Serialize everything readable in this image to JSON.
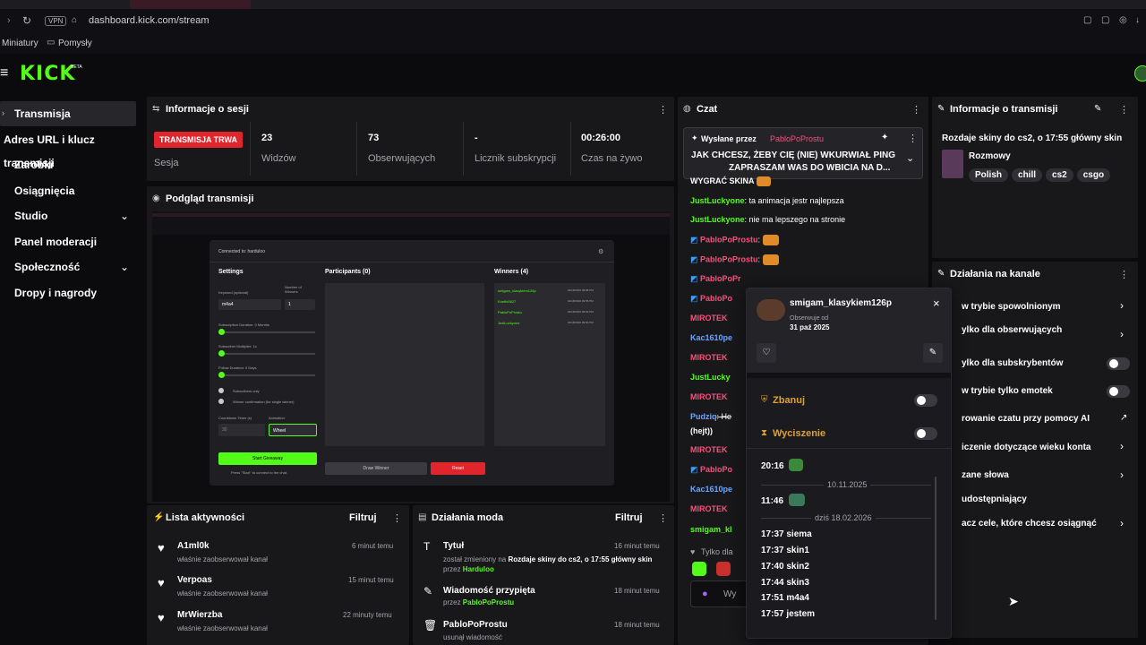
{
  "browser": {
    "url": "dashboard.kick.com/stream",
    "vpn": "VPN",
    "bookmarks": [
      "Miniatury",
      "Pomysły"
    ]
  },
  "brand": {
    "logo": "KICK",
    "beta": "BETA",
    "accent": "#53fc18"
  },
  "sidebar": {
    "items": [
      {
        "label": "Transmisja",
        "active": true
      },
      {
        "label": "Adres URL i klucz transmisji"
      },
      {
        "label": "Zarobki"
      },
      {
        "label": "Osiągnięcia"
      },
      {
        "label": "Studio"
      },
      {
        "label": "Panel moderacji"
      },
      {
        "label": "Społeczność"
      },
      {
        "label": "Dropy i nagrody"
      }
    ]
  },
  "session": {
    "title": "Informacje o sesji",
    "status": "TRANSMISJA TRWA",
    "status_label": "Sesja",
    "stats": [
      {
        "value": "23",
        "label": "Widzów"
      },
      {
        "value": "73",
        "label": "Obserwujących"
      },
      {
        "value": "-",
        "label": "Licznik subskrypcji"
      },
      {
        "value": "00:26:00",
        "label": "Czas na żywo"
      }
    ]
  },
  "preview": {
    "title": "Podgląd transmisji",
    "inner": {
      "connected": "Connected to: harduloo",
      "settings": "Settings",
      "participants": "Participants (0)",
      "winners": "Winners (4)",
      "keyword_label": "Keyword (optional)",
      "keyword_value": "m4a4",
      "number_label": "Number of Winners",
      "number_value": "1",
      "sub_duration": "Subscription Duration: 0 Months",
      "sub_multiplier": "Subscriber Multiplier: 1x",
      "follow_duration": "Follow Duration: 0 Days",
      "subs_only": "Subscribers only",
      "winner_confirm": "Winner confirmation (for single winner)",
      "countdown_label": "Countdown Timer (s)",
      "countdown_value": "30",
      "animation_label": "Animation",
      "animation_value": "Wheel",
      "start_button": "Start Giveaway",
      "press_start": "Press \"Start\" to connect to the chat.",
      "draw_button": "Draw Winner",
      "reset_button": "Reset",
      "winners_list": [
        {
          "name": "smigam_klasykiem126p",
          "time": "02/18/2026 09:58 PM"
        },
        {
          "name": "Koelfo5627",
          "time": "02/18/2026 09:55 PM"
        },
        {
          "name": "PabloPoProstu",
          "time": "02/18/2026 09:52 PM"
        },
        {
          "name": "JustLuckyone",
          "time": "02/18/2026 09:50 PM"
        }
      ]
    }
  },
  "activity": {
    "title": "Lista aktywności",
    "filter": "Filtruj",
    "items": [
      {
        "name": "A1ml0k",
        "desc": "właśnie zaobserwował kanał",
        "time": "6 minut temu"
      },
      {
        "name": "Verpoas",
        "desc": "właśnie zaobserwował kanał",
        "time": "15 minut temu"
      },
      {
        "name": "MrWierzba",
        "desc": "właśnie zaobserwował kanał",
        "time": "22 minuty temu"
      }
    ]
  },
  "modactions": {
    "title": "Działania moda",
    "filter": "Filtruj",
    "items": [
      {
        "title": "Tytuł",
        "line1": "został zmieniony na ",
        "bold": "Rozdaje skiny do cs2, o 17:55 główny skin",
        "by": " przez ",
        "user": "Harduloo",
        "time": "16 minut temu"
      },
      {
        "title": "Wiadomość przypięta",
        "line1": "przez ",
        "bold": "",
        "by": "",
        "user": "PabloPoProstu",
        "time": "18 minut temu"
      },
      {
        "title": "PabloPoProstu",
        "line1": "usunął wiadomość",
        "bold": "",
        "by": "",
        "user": "",
        "time": "18 minut temu"
      }
    ]
  },
  "chat": {
    "title": "Czat",
    "pinned_by_label": "Wysłane przez",
    "pinned_by": "PabloPoProstu",
    "pinned_text": "JAK CHCESZ, ŻEBY CIĘ (NIE) WKURWIAŁ PING",
    "pinned_text2": "ZAPRASZAM WAS DO WBICIA NA D...",
    "messages": [
      {
        "user": "",
        "text": "WYGRAĆ SKINA",
        "color": "#ffffff"
      },
      {
        "user": "JustLuckyone",
        "text": ": ta animacja jestr najlepsza",
        "color": "#53fc18"
      },
      {
        "user": "JustLuckyone",
        "text": ": nie ma lepszego na stronie",
        "color": "#53fc18"
      },
      {
        "user": "PabloPoProstu",
        "text": ":",
        "color": "#ff4d7a"
      },
      {
        "user": "PabloPoProstu",
        "text": ":",
        "color": "#ff4d7a"
      },
      {
        "user": "PabloPoPr",
        "text": "",
        "color": "#ff4d7a"
      },
      {
        "user": "PabloPo",
        "text": "",
        "color": "#ff4d7a"
      },
      {
        "user": "MIROTEK",
        "text": "",
        "color": "#ff4d7a"
      },
      {
        "user": "Kac1610pe",
        "text": "",
        "color": "#6aa6ff"
      },
      {
        "user": "MIROTEK",
        "text": "",
        "color": "#ff4d7a"
      },
      {
        "user": "JustLucky",
        "text": "",
        "color": "#53fc18"
      },
      {
        "user": "MIROTEK",
        "text": "",
        "color": "#ff4d7a"
      },
      {
        "user": "Pudziq",
        "text": ": He",
        "color": "#6aa6ff"
      },
      {
        "user": "",
        "text": "(hejt))",
        "color": "#ffffff"
      },
      {
        "user": "MIROTEK",
        "text": "",
        "color": "#ff4d7a"
      },
      {
        "user": "PabloPo",
        "text": "",
        "color": "#ff4d7a"
      },
      {
        "user": "Kac1610pe",
        "text": "",
        "color": "#6aa6ff"
      },
      {
        "user": "MIROTEK",
        "text": "",
        "color": "#ff4d7a"
      },
      {
        "user": "smigam_kl",
        "text": "",
        "color": "#53fc18"
      }
    ],
    "only_label": "Tylko dla",
    "input_placeholder": "Wy"
  },
  "user_popup": {
    "username": "smigam_klasykiem126p",
    "follows_label": "Obserwuje od",
    "follows_date": "31 paź 2025",
    "ban": "Zbanuj",
    "timeout": "Wyciszenie",
    "history": [
      {
        "type": "msg",
        "time": "20:16",
        "text": ""
      },
      {
        "type": "sep",
        "text": "10.11.2025"
      },
      {
        "type": "msg",
        "time": "11:46",
        "text": ""
      },
      {
        "type": "sep",
        "text": "dziś 18.02.2026"
      },
      {
        "type": "msg",
        "time": "17:37",
        "text": "siema"
      },
      {
        "type": "msg",
        "time": "17:37",
        "text": "skin1"
      },
      {
        "type": "msg",
        "time": "17:40",
        "text": "skin2"
      },
      {
        "type": "msg",
        "time": "17:44",
        "text": "skin3"
      },
      {
        "type": "msg",
        "time": "17:51",
        "text": "m4a4"
      },
      {
        "type": "msg",
        "time": "17:57",
        "text": "jestem"
      }
    ]
  },
  "stream_info": {
    "title": "Informacje o transmisji",
    "stream_title": "Rozdaje skiny do cs2, o 17:55 główny skin",
    "category": "Rozmowy",
    "tags": [
      "Polish",
      "chill",
      "cs2",
      "csgo"
    ]
  },
  "channel_actions": {
    "title": "Działania na kanale",
    "items": [
      {
        "label": "w trybie spowolnionym",
        "control": "chevron"
      },
      {
        "label": "ylko dla obserwujących",
        "control": "chevron"
      },
      {
        "label": "ylko dla subskrybentów",
        "control": "toggle"
      },
      {
        "label": "w trybie tylko emotek",
        "control": "toggle"
      },
      {
        "label": "rowanie czatu przy pomocy AI",
        "control": "external"
      },
      {
        "label": "iczenie dotyczące wieku konta",
        "control": "chevron"
      },
      {
        "label": "zane słowa",
        "control": "chevron"
      },
      {
        "label": "udostępniający",
        "control": "none"
      },
      {
        "label": "acz cele, które chcesz osiągnąć",
        "control": "chevron"
      }
    ]
  }
}
